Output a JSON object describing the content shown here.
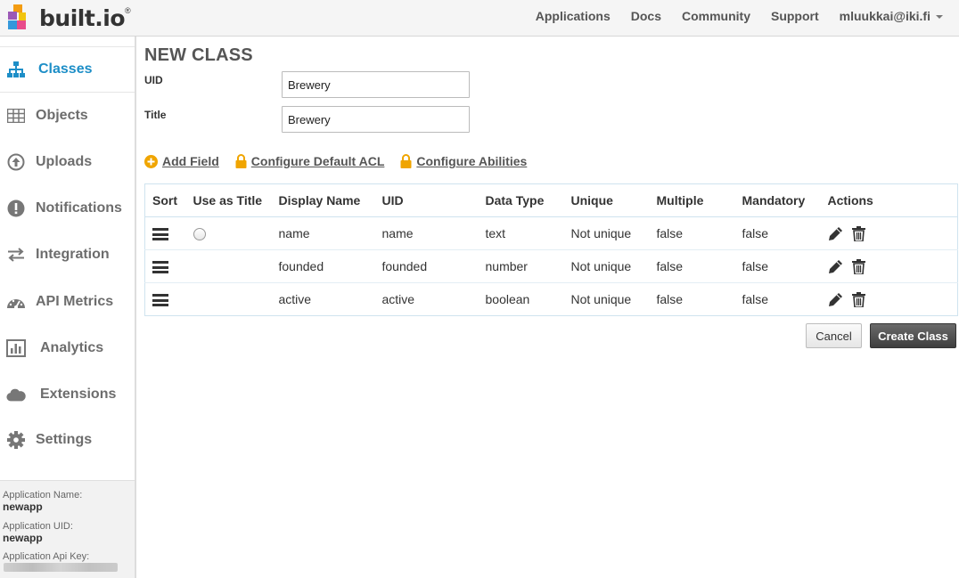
{
  "brand": {
    "name": "built.io",
    "reg": "®"
  },
  "topnav": {
    "applications": "Applications",
    "docs": "Docs",
    "community": "Community",
    "support": "Support",
    "user": "mluukkai@iki.fi"
  },
  "sidebar": {
    "items": [
      {
        "label": "Classes",
        "icon": "sitemap-icon",
        "active": true
      },
      {
        "label": "Objects",
        "icon": "table-icon"
      },
      {
        "label": "Uploads",
        "icon": "upload-icon"
      },
      {
        "label": "Notifications",
        "icon": "alert-icon"
      },
      {
        "label": "Integration",
        "icon": "arrows-icon"
      },
      {
        "label": "API Metrics",
        "icon": "dashboard-icon"
      },
      {
        "label": "Analytics",
        "icon": "bar-chart-icon"
      },
      {
        "label": "Extensions",
        "icon": "cloud-icon"
      },
      {
        "label": "Settings",
        "icon": "gear-icon"
      }
    ],
    "app_info": {
      "name_label": "Application Name:",
      "name_value": "newapp",
      "uid_label": "Application UID:",
      "uid_value": "newapp",
      "key_label": "Application Api Key:"
    }
  },
  "form": {
    "title": "NEW CLASS",
    "uid_label": "UID",
    "uid_value": "Brewery",
    "title_label": "Title",
    "title_value": "Brewery"
  },
  "links": {
    "add_field": "Add Field",
    "default_acl": "Configure Default ACL",
    "abilities": "Configure Abilities"
  },
  "table": {
    "headers": [
      "Sort",
      "Use as Title",
      "Display Name",
      "UID",
      "Data Type",
      "Unique",
      "Multiple",
      "Mandatory",
      "Actions"
    ],
    "rows": [
      {
        "display": "name",
        "uid": "name",
        "type": "text",
        "unique": "Not unique",
        "multiple": "false",
        "mandatory": "false"
      },
      {
        "display": "founded",
        "uid": "founded",
        "type": "number",
        "unique": "Not unique",
        "multiple": "false",
        "mandatory": "false"
      },
      {
        "display": "active",
        "uid": "active",
        "type": "boolean",
        "unique": "Not unique",
        "multiple": "false",
        "mandatory": "false"
      }
    ]
  },
  "buttons": {
    "cancel": "Cancel",
    "create": "Create Class"
  },
  "colors": {
    "accent": "#1d8ec7",
    "lock": "#f0a500",
    "add": "#f0a500"
  }
}
